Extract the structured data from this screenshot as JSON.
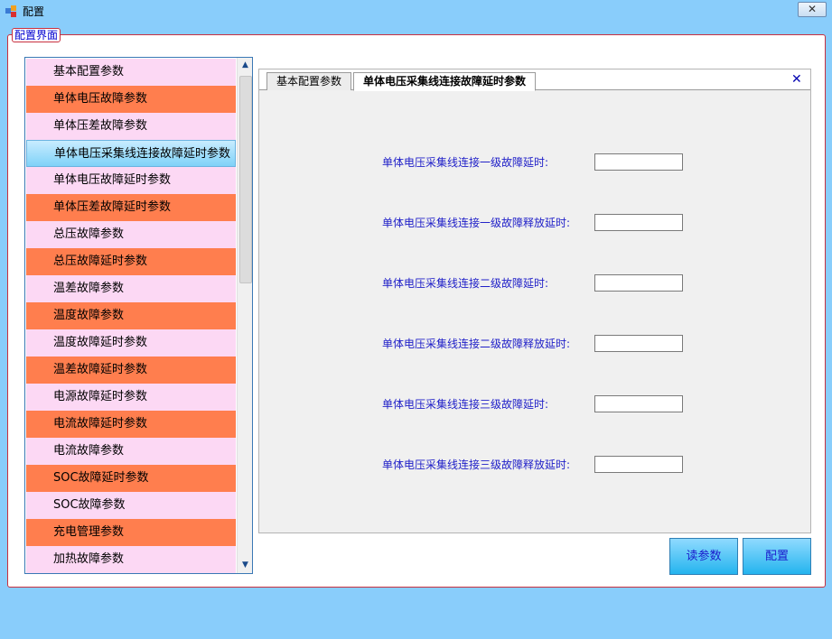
{
  "window": {
    "title": "配置",
    "close_symbol": "✕"
  },
  "group_label": "配置界面",
  "list": {
    "items": [
      {
        "label": "基本配置参数",
        "style": "pink"
      },
      {
        "label": "单体电压故障参数",
        "style": "orange"
      },
      {
        "label": "单体压差故障参数",
        "style": "pink"
      },
      {
        "label": "单体电压采集线连接故障延时参数",
        "style": "selected"
      },
      {
        "label": "单体电压故障延时参数",
        "style": "pink"
      },
      {
        "label": "单体压差故障延时参数",
        "style": "orange"
      },
      {
        "label": "总压故障参数",
        "style": "pink"
      },
      {
        "label": "总压故障延时参数",
        "style": "orange"
      },
      {
        "label": "温差故障参数",
        "style": "pink"
      },
      {
        "label": "温度故障参数",
        "style": "orange"
      },
      {
        "label": "温度故障延时参数",
        "style": "pink"
      },
      {
        "label": "温差故障延时参数",
        "style": "orange"
      },
      {
        "label": "电源故障延时参数",
        "style": "pink"
      },
      {
        "label": "电流故障延时参数",
        "style": "orange"
      },
      {
        "label": "电流故障参数",
        "style": "pink"
      },
      {
        "label": "SOC故障延时参数",
        "style": "orange"
      },
      {
        "label": "SOC故障参数",
        "style": "pink"
      },
      {
        "label": "充电管理参数",
        "style": "orange"
      },
      {
        "label": "加热故障参数",
        "style": "pink"
      }
    ]
  },
  "tabs": [
    {
      "label": "基本配置参数",
      "active": false
    },
    {
      "label": "单体电压采集线连接故障延时参数",
      "active": true
    }
  ],
  "tab_close_symbol": "✕",
  "fields": [
    {
      "label": "单体电压采集线连接一级故障延时:",
      "value": ""
    },
    {
      "label": "单体电压采集线连接一级故障释放延时:",
      "value": ""
    },
    {
      "label": "单体电压采集线连接二级故障延时:",
      "value": ""
    },
    {
      "label": "单体电压采集线连接二级故障释放延时:",
      "value": ""
    },
    {
      "label": "单体电压采集线连接三级故障延时:",
      "value": ""
    },
    {
      "label": "单体电压采集线连接三级故障释放延时:",
      "value": ""
    }
  ],
  "buttons": {
    "read": "读参数",
    "config": "配置"
  },
  "colors": {
    "background": "#89cdfb",
    "pink": "#fcd8f4",
    "orange": "#ff7e4e",
    "label_blue": "#2020c8",
    "frame_red": "#c8303f"
  },
  "icons": {
    "scroll_up": "▲",
    "scroll_down": "▼"
  }
}
